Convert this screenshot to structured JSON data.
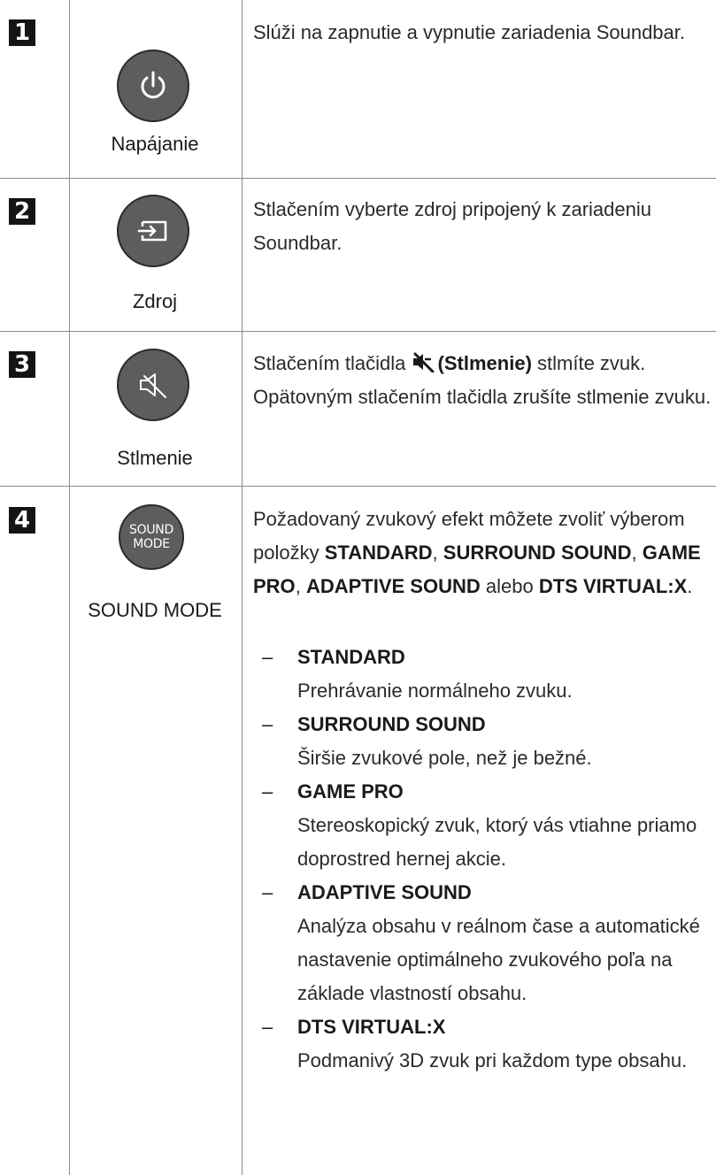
{
  "rows": [
    {
      "number": "1",
      "icon": "power-icon",
      "label": "Napájanie",
      "description": "Slúži na zapnutie a vypnutie zariadenia Soundbar."
    },
    {
      "number": "2",
      "icon": "source-icon",
      "label": "Zdroj",
      "description": "Stlačením vyberte zdroj pripojený k zariadeniu Soundbar."
    },
    {
      "number": "3",
      "icon": "mute-icon",
      "label": "Stlmenie",
      "description_pre": "Stlačením tlačidla",
      "description_bold": "(Stlmenie)",
      "description_post": "stlmíte zvuk. Opätovným stlačením tlačidla zrušíte stlmenie zvuku."
    },
    {
      "number": "4",
      "icon_text_line1": "SOUND",
      "icon_text_line2": "MODE",
      "label": "SOUND MODE",
      "intro_1": "Požadovaný zvukový efekt môžete zvoliť výberom položky",
      "intro_b1": "STANDARD",
      "intro_sep1": ",",
      "intro_b2": "SURROUND SOUND",
      "intro_sep2": ",",
      "intro_b3": "GAME PRO",
      "intro_sep3": ",",
      "intro_b4": "ADAPTIVE SOUND",
      "intro_sep4": "alebo",
      "intro_b5": "DTS VIRTUAL:X",
      "intro_end": ".",
      "modes": [
        {
          "dash": "–",
          "name": "STANDARD",
          "desc": "Prehrávanie normálneho zvuku."
        },
        {
          "dash": "–",
          "name": "SURROUND SOUND",
          "desc": "Širšie zvukové pole, než je bežné."
        },
        {
          "dash": "–",
          "name": "GAME PRO",
          "desc": "Stereoskopický zvuk, ktorý vás vtiahne priamo doprostred hernej akcie."
        },
        {
          "dash": "–",
          "name": "ADAPTIVE SOUND",
          "desc": "Analýza obsahu v reálnom čase a automatické nastavenie optimálneho zvukového poľa na základe vlastností obsahu."
        },
        {
          "dash": "–",
          "name": "DTS VIRTUAL:X",
          "desc": "Podmanivý 3D zvuk pri každom type obsahu."
        }
      ]
    }
  ]
}
